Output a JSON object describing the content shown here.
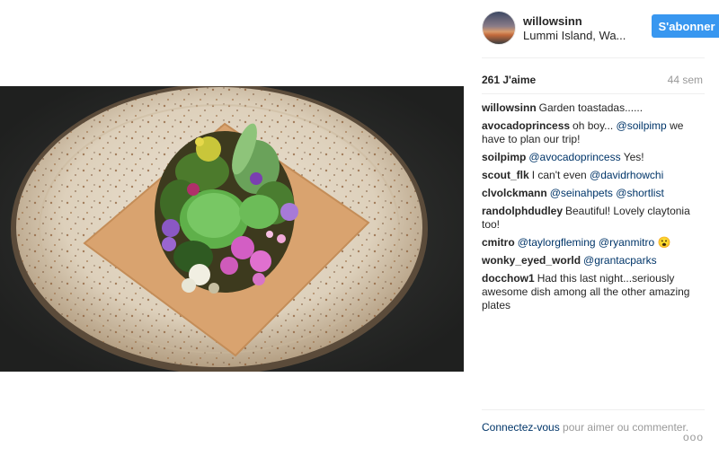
{
  "post": {
    "username": "willowsinn",
    "location": "Lummi Island, Wa...",
    "follow_label": "S'abonner",
    "likes": "261 J'aime",
    "timestamp": "44 sem"
  },
  "comments": [
    {
      "user": "willowsinn",
      "parts": [
        {
          "t": "Garden toastadas......"
        }
      ]
    },
    {
      "user": "avocadoprincess",
      "parts": [
        {
          "t": "oh boy... "
        },
        {
          "t": "@soilpimp",
          "m": true
        },
        {
          "t": " we have to plan our trip!"
        }
      ]
    },
    {
      "user": "soilpimp",
      "parts": [
        {
          "t": "@avocadoprincess",
          "m": true
        },
        {
          "t": " Yes!"
        }
      ]
    },
    {
      "user": "scout_flk",
      "parts": [
        {
          "t": "I can't even "
        },
        {
          "t": "@davidrhowchi",
          "m": true
        }
      ]
    },
    {
      "user": "clvolckmann",
      "parts": [
        {
          "t": "@seinahpets",
          "m": true
        },
        {
          "t": " "
        },
        {
          "t": "@shortlist",
          "m": true
        }
      ]
    },
    {
      "user": "randolphdudley",
      "parts": [
        {
          "t": "Beautiful! Lovely claytonia too!"
        }
      ]
    },
    {
      "user": "cmitro",
      "parts": [
        {
          "t": "@taylorgfleming",
          "m": true
        },
        {
          "t": " "
        },
        {
          "t": "@ryanmitro",
          "m": true
        },
        {
          "t": " 😮"
        }
      ]
    },
    {
      "user": "wonky_eyed_world",
      "parts": [
        {
          "t": "@grantacparks",
          "m": true
        }
      ]
    },
    {
      "user": "docchow1",
      "parts": [
        {
          "t": "Had this last night...seriously awesome dish among all the other amazing plates"
        }
      ]
    }
  ],
  "footer": {
    "login_link": "Connectez-vous",
    "login_text": " pour aimer ou commenter.",
    "more_icon": "ooo"
  },
  "icons": {
    "more": "more-options-icon"
  }
}
